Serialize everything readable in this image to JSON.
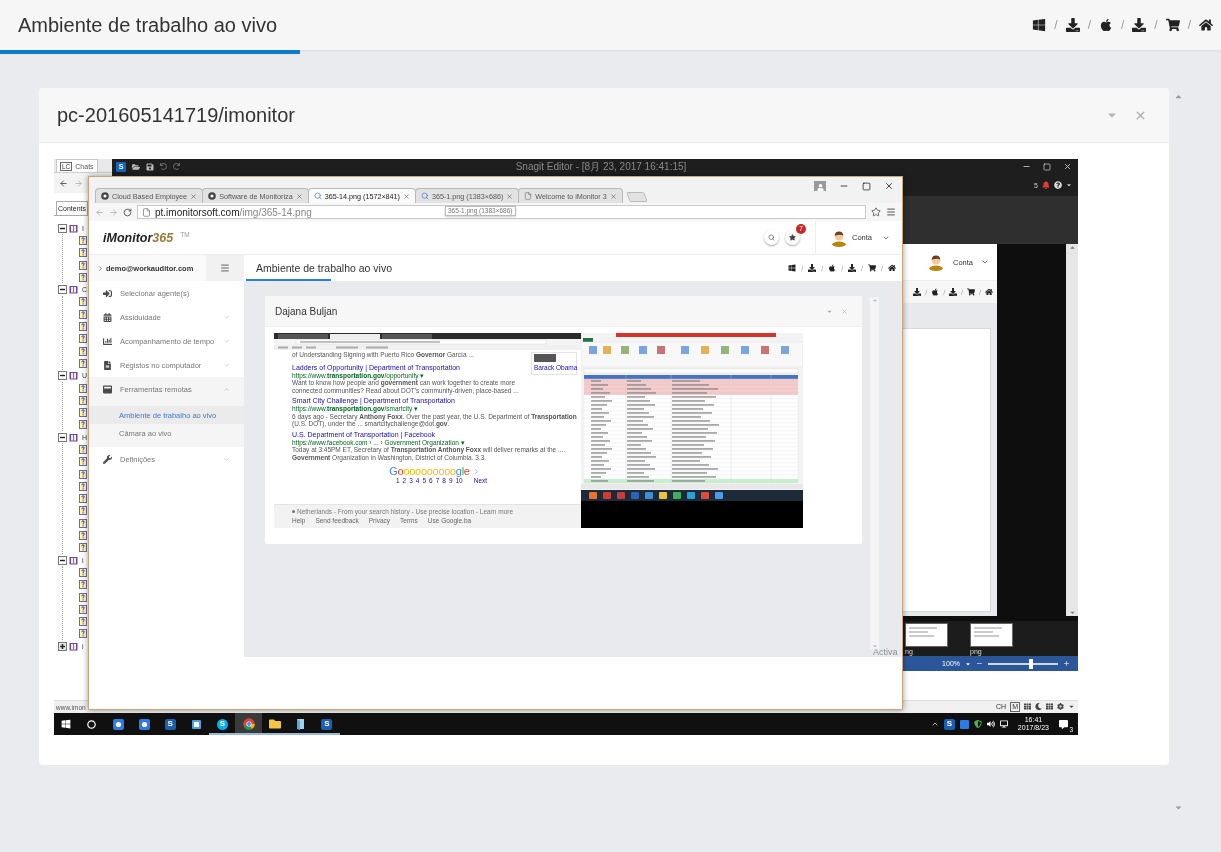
{
  "header": {
    "title": "Ambiente de trabalho ao vivo",
    "actions": [
      {
        "kind": "windows",
        "separator": "/"
      },
      {
        "kind": "download",
        "separator": "/"
      },
      {
        "kind": "apple",
        "separator": "/"
      },
      {
        "kind": "download",
        "separator": "/"
      },
      {
        "kind": "cart",
        "separator": "/"
      },
      {
        "kind": "home"
      }
    ]
  },
  "panel": {
    "title": "pc-201605141719/imonitor"
  },
  "remote_desktop": {
    "help_window": {
      "tab": "Chats",
      "tab_logo": "LC",
      "contents_tab": "Contents",
      "tree": [
        {
          "label": "I",
          "expanded": true,
          "children": [
            {
              "kind": "page"
            },
            {
              "kind": "page"
            },
            {
              "kind": "page"
            },
            {
              "kind": "page"
            }
          ]
        },
        {
          "label": "C",
          "expanded": true,
          "children": [
            {
              "kind": "page"
            },
            {
              "kind": "page"
            },
            {
              "kind": "page"
            },
            {
              "kind": "page"
            },
            {
              "kind": "page"
            },
            {
              "kind": "page"
            }
          ]
        },
        {
          "label": "U",
          "expanded": true,
          "children": [
            {
              "kind": "page"
            },
            {
              "kind": "page"
            },
            {
              "kind": "page"
            },
            {
              "kind": "page"
            }
          ]
        },
        {
          "label": "H",
          "expanded": true,
          "children": [
            {
              "kind": "page"
            },
            {
              "kind": "page"
            },
            {
              "kind": "page"
            },
            {
              "kind": "page"
            },
            {
              "kind": "page"
            },
            {
              "kind": "page"
            },
            {
              "kind": "page"
            },
            {
              "kind": "page"
            },
            {
              "kind": "page"
            }
          ]
        },
        {
          "label": "i",
          "expanded": true,
          "children": [
            {
              "kind": "page"
            },
            {
              "kind": "page"
            },
            {
              "kind": "page"
            },
            {
              "kind": "page"
            },
            {
              "kind": "page"
            },
            {
              "kind": "page"
            }
          ]
        },
        {
          "label": "i",
          "expanded": false
        }
      ],
      "status": "www.imon"
    },
    "snagit": {
      "logo": "S",
      "title": "Snagit Editor - [8月 23, 2017 16:41:15]",
      "notifications": "5",
      "capture": {
        "account": "Conta",
        "actions": [
          {
            "kind": "download",
            "separator": "/"
          },
          {
            "kind": "apple",
            "separator": "/"
          },
          {
            "kind": "download",
            "separator": "/"
          },
          {
            "kind": "cart",
            "separator": "/"
          },
          {
            "kind": "home"
          }
        ]
      },
      "thumbnails": [
        {
          "label": "ng"
        },
        {
          "label": "png"
        }
      ],
      "zoom": "100%",
      "zoom_slider": {
        "level": 0.62
      }
    },
    "activation_notice": "Activa",
    "browser": {
      "tabs": [
        {
          "title": "Cloud Based Employee",
          "kind": "web",
          "selected": false
        },
        {
          "title": "Software de Monitoriza",
          "kind": "web",
          "selected": false
        },
        {
          "title": "365-14.png (1572×841)",
          "kind": "image",
          "selected": true
        },
        {
          "title": "365-1.png (1383×686)",
          "kind": "image",
          "selected": false
        },
        {
          "title": "Welcome to iMonitor 3",
          "kind": "page",
          "selected": false
        }
      ],
      "tooltip": "365-1.png (1383×686)",
      "url": {
        "host": "pt.imonitorsoft.com",
        "path": "/img/365-14.png"
      },
      "app": {
        "logo": {
          "name": "iMonitor",
          "number": "365",
          "mark": "TM"
        },
        "notifications": "7",
        "account": "Conta",
        "user": "demo@workauditor.com",
        "menu": [
          {
            "label": "Selecionar agente(s)",
            "kind": "link"
          },
          {
            "label": "Assiduidade",
            "kind": "group",
            "expanded": false
          },
          {
            "label": "Acompanhamento de tempo",
            "kind": "group",
            "expanded": false
          },
          {
            "label": "Registos no computador",
            "kind": "group",
            "expanded": false
          },
          {
            "label": "Ferramentas remotas",
            "kind": "group",
            "expanded": true,
            "children": [
              {
                "label": "Ambiente de trabalho ao vivo",
                "selected": true
              },
              {
                "label": "Câmara ao vivo",
                "selected": false
              }
            ]
          },
          {
            "label": "Definições",
            "kind": "group",
            "expanded": false
          }
        ],
        "title": "Ambiente de trabalho ao vivo",
        "actions": [
          {
            "kind": "windows",
            "separator": "/"
          },
          {
            "kind": "download",
            "separator": "/"
          },
          {
            "kind": "apple",
            "separator": "/"
          },
          {
            "kind": "download",
            "separator": "/"
          },
          {
            "kind": "cart",
            "separator": "/"
          },
          {
            "kind": "home"
          }
        ],
        "viewer": {
          "title": "Dajana Buljan",
          "screenshot": {
            "top_snippet": "of Understanding Signing with Puerto Rico **Governor** García ...",
            "results": [
              {
                "title": "Ladders of Opportunity | Department of Transportation",
                "url": "https://www.**transportation.gov**/opportunity ▾",
                "snippet": "Want to know how people and **government** can work together to create more connected communities? Read about DOT's community-driven, place-based ..."
              },
              {
                "title": "Smart City Challenge | Department of Transportation",
                "url": "https://www.**transportation.gov**/smartcity ▾",
                "snippet": "6 days ago - Secretary **Anthony Foxx**. Over the past year, the U.S. Department of **Transportation** (U.S. DOT), under the ... smartcitychallenge@dot.**gov**."
              },
              {
                "title": "U.S. Department of Transportation | Facebook",
                "url": "https://www.facebook.com › ... › Government Organization ▾",
                "snippet": "Today at 3:45PM ET, Secretary of **Transportation Anthony Foxx** will deliver remarks at the .... **Government** Organization in Washington, District of Columbia. 3.3."
              }
            ],
            "side_card": {
              "name": "Barack Obama"
            },
            "pager": {
              "logo": "Goooooooooogle",
              "pages": [
                "1",
                "2",
                "3",
                "4",
                "5",
                "6",
                "7",
                "8",
                "9",
                "10"
              ],
              "next": "Next"
            },
            "footer": {
              "location": "Netherlands - From your search history - Use precise location - Learn more",
              "links": [
                "Help",
                "Send feedback",
                "Privacy",
                "Terms",
                "Use Google.ba"
              ]
            }
          }
        }
      }
    },
    "language_bar": {
      "code": "CH",
      "mode": "M",
      "tools": [
        {
          "kind": "grid"
        },
        {
          "kind": "moon"
        },
        {
          "kind": "grid"
        },
        {
          "kind": "gear"
        },
        {
          "kind": "caret"
        }
      ]
    },
    "taskbar": {
      "apps": [
        {
          "kind": "start",
          "selected": false,
          "running": false
        },
        {
          "kind": "search",
          "selected": false,
          "running": false
        },
        {
          "kind": "tile",
          "selected": false,
          "running": false
        },
        {
          "kind": "tile",
          "selected": false,
          "running": false
        },
        {
          "kind": "snagit",
          "label": "S",
          "selected": false,
          "running": false
        },
        {
          "kind": "note",
          "selected": false,
          "running": false
        },
        {
          "kind": "skype",
          "label": "S",
          "selected": false,
          "running": true
        },
        {
          "kind": "chrome",
          "selected": true,
          "running": true
        },
        {
          "kind": "folder",
          "selected": false,
          "running": true
        },
        {
          "kind": "notepad",
          "selected": false,
          "running": true
        },
        {
          "kind": "snagit",
          "label": "S",
          "selected": false,
          "running": true
        }
      ],
      "tray": [
        {
          "kind": "chevron"
        },
        {
          "kind": "snagit",
          "label": "S"
        },
        {
          "kind": "tile"
        },
        {
          "kind": "shield"
        },
        {
          "kind": "speaker"
        },
        {
          "kind": "screen"
        }
      ],
      "time": "16:41",
      "date": "2017/8/23",
      "notifications": "3"
    }
  }
}
